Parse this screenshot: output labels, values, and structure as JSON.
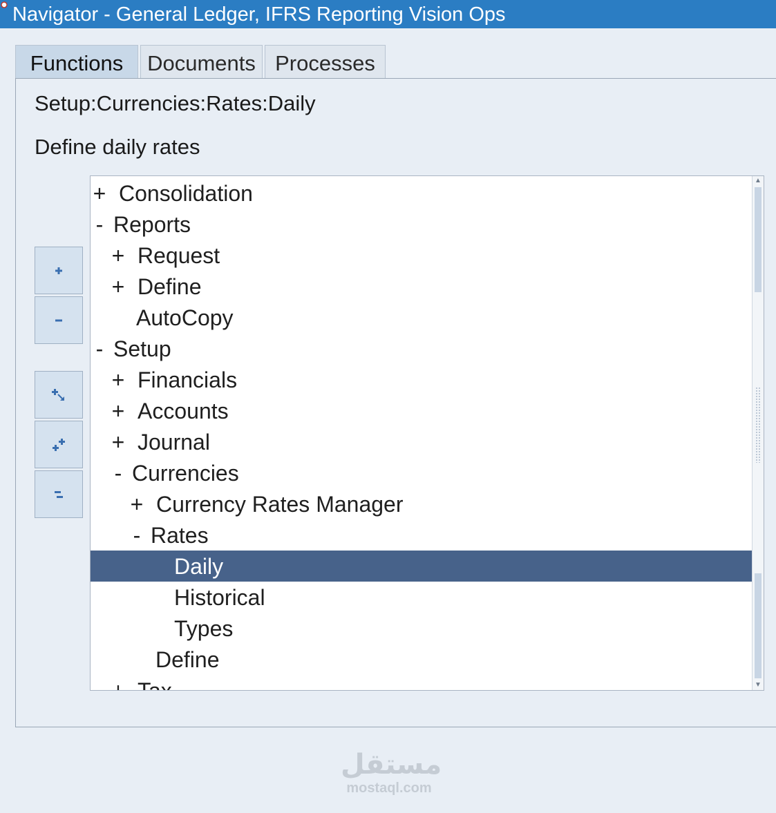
{
  "window": {
    "title": "Navigator - General Ledger, IFRS Reporting Vision Ops"
  },
  "tabs": [
    {
      "label": "Functions",
      "active": true
    },
    {
      "label": "Documents",
      "active": false
    },
    {
      "label": "Processes",
      "active": false
    }
  ],
  "breadcrumb": "Setup:Currencies:Rates:Daily",
  "description": "Define daily rates",
  "tree": {
    "items": [
      {
        "toggle": "+",
        "label": "Consolidation",
        "level": 0
      },
      {
        "toggle": "-",
        "label": "Reports",
        "level": 0
      },
      {
        "toggle": "+",
        "label": "Request",
        "level": 1
      },
      {
        "toggle": "+",
        "label": "Define",
        "level": 1
      },
      {
        "toggle": "",
        "label": "AutoCopy",
        "level": 1
      },
      {
        "toggle": "-",
        "label": "Setup",
        "level": 0
      },
      {
        "toggle": "+",
        "label": "Financials",
        "level": 1
      },
      {
        "toggle": "+",
        "label": "Accounts",
        "level": 1
      },
      {
        "toggle": "+",
        "label": "Journal",
        "level": 1
      },
      {
        "toggle": "-",
        "label": "Currencies",
        "level": 1
      },
      {
        "toggle": "+",
        "label": "Currency Rates Manager",
        "level": 2
      },
      {
        "toggle": "-",
        "label": "Rates",
        "level": 2
      },
      {
        "toggle": "",
        "label": "Daily",
        "level": 3,
        "selected": true
      },
      {
        "toggle": "",
        "label": "Historical",
        "level": 3
      },
      {
        "toggle": "",
        "label": "Types",
        "level": 3
      },
      {
        "toggle": "",
        "label": "Define",
        "level": 2
      },
      {
        "toggle": "+",
        "label": "Tax",
        "level": 1
      }
    ]
  },
  "side_buttons": [
    {
      "name": "expand-button",
      "icon": "expand-icon"
    },
    {
      "name": "collapse-button",
      "icon": "collapse-icon"
    },
    {
      "name": "expand-branch-button",
      "icon": "expand-branch-icon"
    },
    {
      "name": "expand-all-button",
      "icon": "expand-all-icon"
    },
    {
      "name": "collapse-all-button",
      "icon": "collapse-all-icon"
    }
  ],
  "watermark": {
    "logo_text": "مستقل",
    "url": "mostaql.com"
  },
  "colors": {
    "titlebar": "#2b7dc3",
    "selection": "#47628a",
    "background": "#e8eef5"
  }
}
